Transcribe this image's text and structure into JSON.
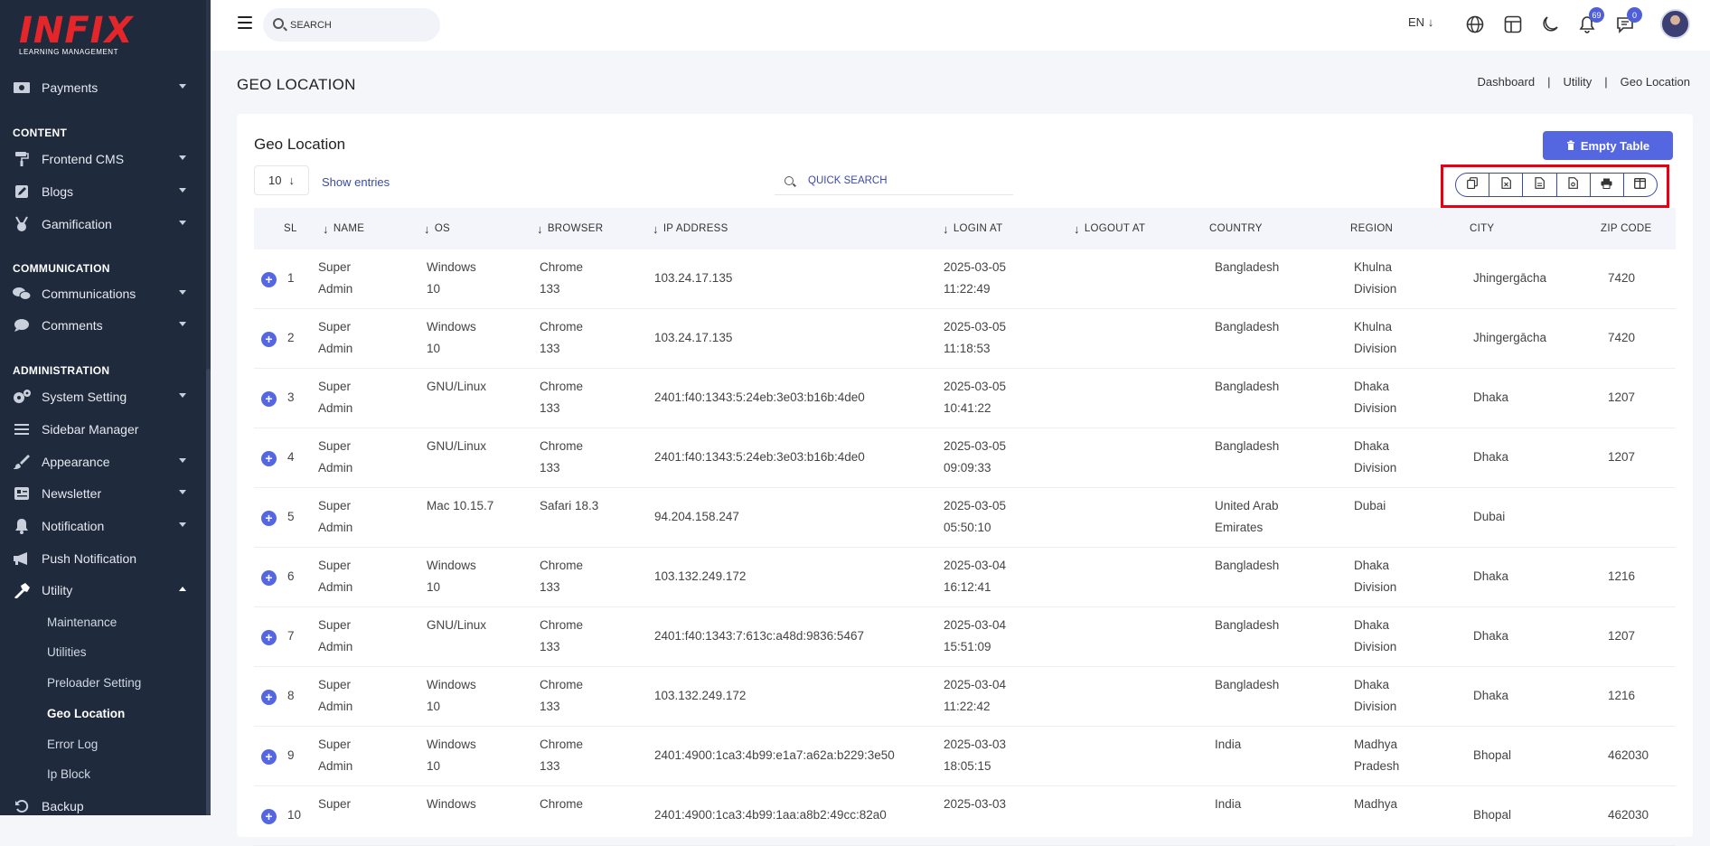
{
  "logo": {
    "mark": "INFIX",
    "sub": "LEARNING MANAGEMENT"
  },
  "sidebar": {
    "sections": [
      {
        "label": "CONTENT"
      },
      {
        "label": "COMMUNICATION"
      },
      {
        "label": "ADMINISTRATION"
      }
    ],
    "items": [
      {
        "label": "Payments",
        "icon": "money-icon"
      },
      {
        "label": "Frontend CMS",
        "icon": "paint-roller-icon"
      },
      {
        "label": "Blogs",
        "icon": "edit-icon"
      },
      {
        "label": "Gamification",
        "icon": "medal-icon"
      },
      {
        "label": "Communications",
        "icon": "chat-icon"
      },
      {
        "label": "Comments",
        "icon": "comment-icon"
      },
      {
        "label": "System Setting",
        "icon": "gears-icon"
      },
      {
        "label": "Sidebar Manager",
        "icon": "bars-icon"
      },
      {
        "label": "Appearance",
        "icon": "brush-icon"
      },
      {
        "label": "Newsletter",
        "icon": "newsletter-icon"
      },
      {
        "label": "Notification",
        "icon": "bell-icon"
      },
      {
        "label": "Push Notification",
        "icon": "megaphone-icon"
      },
      {
        "label": "Utility",
        "icon": "hammer-icon"
      },
      {
        "label": "Backup",
        "icon": "backup-icon"
      }
    ],
    "utility_sub": [
      "Maintenance",
      "Utilities",
      "Preloader Setting",
      "Geo Location",
      "Error Log",
      "Ip Block"
    ]
  },
  "topbar": {
    "search_placeholder": "SEARCH",
    "lang": "EN",
    "notif_count": "69",
    "msg_count": "0"
  },
  "page": {
    "title": "GEO LOCATION",
    "breadcrumbs": [
      "Dashboard",
      "Utility",
      "Geo Location"
    ]
  },
  "card": {
    "title": "Geo Location",
    "empty_button": "Empty Table",
    "length_value": "10",
    "show_entries": "Show entries",
    "quick_search_placeholder": "QUICK SEARCH"
  },
  "table": {
    "columns": [
      "SL",
      "NAME",
      "OS",
      "BROWSER",
      "IP ADDRESS",
      "LOGIN AT",
      "LOGOUT AT",
      "COUNTRY",
      "REGION",
      "CITY",
      "ZIP CODE"
    ],
    "rows": [
      {
        "sl": "1",
        "name1": "Super",
        "name2": "Admin",
        "os1": "Windows",
        "os2": "10",
        "br1": "Chrome",
        "br2": "133",
        "ip": "103.24.17.135",
        "login1": "2025-03-05",
        "login2": "11:22:49",
        "logout": "",
        "country1": "Bangladesh",
        "country2": "",
        "region1": "Khulna",
        "region2": "Division",
        "city": "Jhingergācha",
        "zip": "7420"
      },
      {
        "sl": "2",
        "name1": "Super",
        "name2": "Admin",
        "os1": "Windows",
        "os2": "10",
        "br1": "Chrome",
        "br2": "133",
        "ip": "103.24.17.135",
        "login1": "2025-03-05",
        "login2": "11:18:53",
        "logout": "",
        "country1": "Bangladesh",
        "country2": "",
        "region1": "Khulna",
        "region2": "Division",
        "city": "Jhingergācha",
        "zip": "7420"
      },
      {
        "sl": "3",
        "name1": "Super",
        "name2": "Admin",
        "os1": "GNU/Linux",
        "os2": "",
        "br1": "Chrome",
        "br2": "133",
        "ip": "2401:f40:1343:5:24eb:3e03:b16b:4de0",
        "login1": "2025-03-05",
        "login2": "10:41:22",
        "logout": "",
        "country1": "Bangladesh",
        "country2": "",
        "region1": "Dhaka",
        "region2": "Division",
        "city": "Dhaka",
        "zip": "1207"
      },
      {
        "sl": "4",
        "name1": "Super",
        "name2": "Admin",
        "os1": "GNU/Linux",
        "os2": "",
        "br1": "Chrome",
        "br2": "133",
        "ip": "2401:f40:1343:5:24eb:3e03:b16b:4de0",
        "login1": "2025-03-05",
        "login2": "09:09:33",
        "logout": "",
        "country1": "Bangladesh",
        "country2": "",
        "region1": "Dhaka",
        "region2": "Division",
        "city": "Dhaka",
        "zip": "1207"
      },
      {
        "sl": "5",
        "name1": "Super",
        "name2": "Admin",
        "os1": "Mac 10.15.7",
        "os2": "",
        "br1": "Safari 18.3",
        "br2": "",
        "ip": "94.204.158.247",
        "login1": "2025-03-05",
        "login2": "05:50:10",
        "logout": "",
        "country1": "United Arab",
        "country2": "Emirates",
        "region1": "Dubai",
        "region2": "",
        "city": "Dubai",
        "zip": ""
      },
      {
        "sl": "6",
        "name1": "Super",
        "name2": "Admin",
        "os1": "Windows",
        "os2": "10",
        "br1": "Chrome",
        "br2": "133",
        "ip": "103.132.249.172",
        "login1": "2025-03-04",
        "login2": "16:12:41",
        "logout": "",
        "country1": "Bangladesh",
        "country2": "",
        "region1": "Dhaka",
        "region2": "Division",
        "city": "Dhaka",
        "zip": "1216"
      },
      {
        "sl": "7",
        "name1": "Super",
        "name2": "Admin",
        "os1": "GNU/Linux",
        "os2": "",
        "br1": "Chrome",
        "br2": "133",
        "ip": "2401:f40:1343:7:613c:a48d:9836:5467",
        "login1": "2025-03-04",
        "login2": "15:51:09",
        "logout": "",
        "country1": "Bangladesh",
        "country2": "",
        "region1": "Dhaka",
        "region2": "Division",
        "city": "Dhaka",
        "zip": "1207"
      },
      {
        "sl": "8",
        "name1": "Super",
        "name2": "Admin",
        "os1": "Windows",
        "os2": "10",
        "br1": "Chrome",
        "br2": "133",
        "ip": "103.132.249.172",
        "login1": "2025-03-04",
        "login2": "11:22:42",
        "logout": "",
        "country1": "Bangladesh",
        "country2": "",
        "region1": "Dhaka",
        "region2": "Division",
        "city": "Dhaka",
        "zip": "1216"
      },
      {
        "sl": "9",
        "name1": "Super",
        "name2": "Admin",
        "os1": "Windows",
        "os2": "10",
        "br1": "Chrome",
        "br2": "133",
        "ip": "2401:4900:1ca3:4b99:e1a7:a62a:b229:3e50",
        "login1": "2025-03-03",
        "login2": "18:05:15",
        "logout": "",
        "country1": "India",
        "country2": "",
        "region1": "Madhya",
        "region2": "Pradesh",
        "city": "Bhopal",
        "zip": "462030"
      },
      {
        "sl": "10",
        "name1": "Super",
        "name2": "",
        "os1": "Windows",
        "os2": "",
        "br1": "Chrome",
        "br2": "",
        "ip": "2401:4900:1ca3:4b99:1aa:a8b2:49cc:82a0",
        "login1": "2025-03-03",
        "login2": "",
        "logout": "",
        "country1": "India",
        "country2": "",
        "region1": "Madhya",
        "region2": "",
        "city": "Bhopal",
        "zip": "462030"
      }
    ]
  },
  "colors": {
    "accent": "#5467e0",
    "sidebar": "#1f2a3d",
    "highlight": "#e60012"
  }
}
